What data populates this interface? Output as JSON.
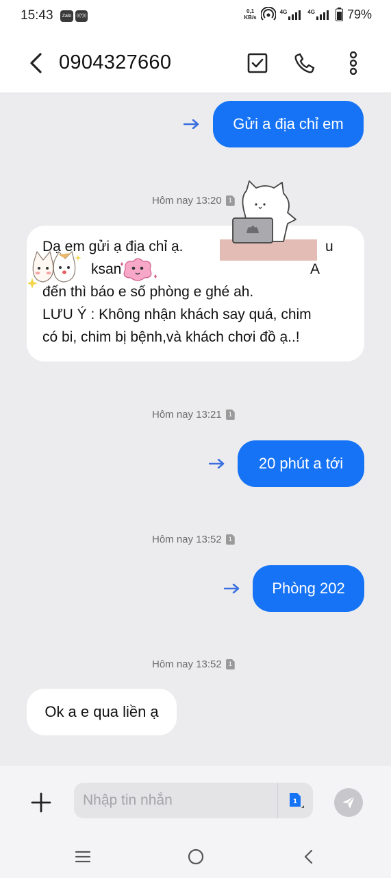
{
  "status_bar": {
    "time": "15:43",
    "app_icons": [
      "Zalo",
      "(((•)))"
    ],
    "net_speed_value": "0,1",
    "net_speed_unit": "KB/s",
    "network_1": "4G",
    "network_2": "4G",
    "battery": "79%"
  },
  "header": {
    "contact": "0904327660",
    "icons": [
      "back-arrow",
      "checkbox-select",
      "phone",
      "more-vertical"
    ]
  },
  "messages": [
    {
      "direction": "outgoing",
      "text": "Gửi a địa chỉ em"
    },
    {
      "type": "timestamp",
      "text": "Hôm nay 13:20",
      "sim": "1"
    },
    {
      "direction": "incoming",
      "lines": [
        "Dạ em gửi ạ địa chỉ ạ.",
        "ksan",
        "đến thì báo e số phòng e ghé ah.",
        "LƯU Ý : Không nhận khách say quá, chim",
        "có bi, chim bị bệnh,và khách chơi đồ ạ..!"
      ],
      "fragment_right_1": "u",
      "fragment_right_2": "A"
    },
    {
      "type": "timestamp",
      "text": "Hôm nay 13:21",
      "sim": "1"
    },
    {
      "direction": "outgoing",
      "text": "20 phút a tới"
    },
    {
      "type": "timestamp",
      "text": "Hôm nay 13:52",
      "sim": "1"
    },
    {
      "direction": "outgoing",
      "text": "Phòng 202"
    },
    {
      "type": "timestamp",
      "text": "Hôm nay 13:52",
      "sim": "1"
    },
    {
      "direction": "incoming",
      "text": "Ok a e qua liền ạ"
    }
  ],
  "input": {
    "placeholder": "Nhập tin nhắn",
    "sim": "1"
  },
  "nav": {
    "icons": [
      "recents-menu",
      "home",
      "back"
    ]
  },
  "colors": {
    "accent": "#1673f5",
    "arrow": "#3b6fe0",
    "background": "#ececee",
    "bubble_incoming": "#ffffff",
    "redaction": "#e3bdb5"
  }
}
